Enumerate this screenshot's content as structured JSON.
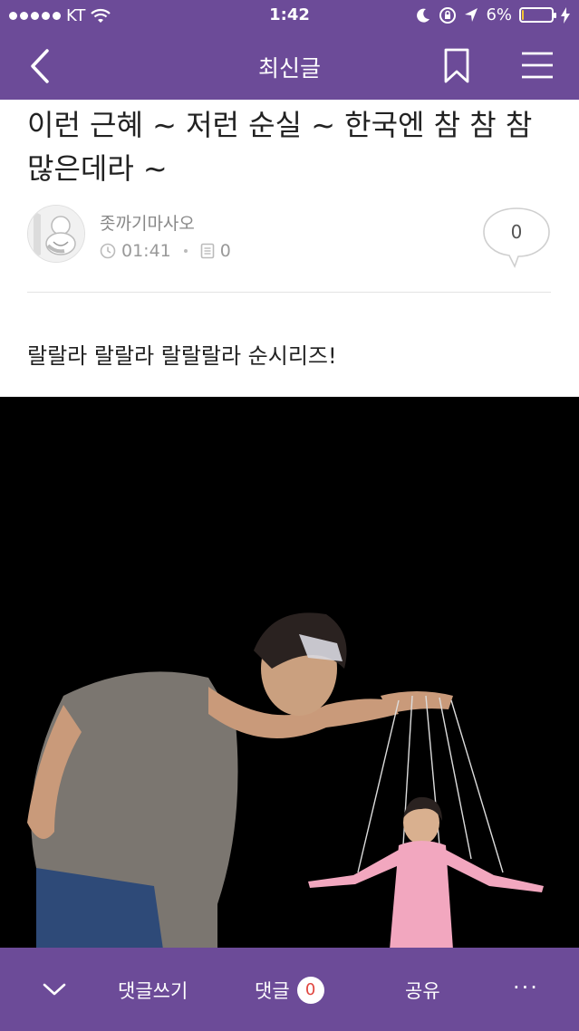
{
  "status_bar": {
    "carrier": "KT",
    "time": "1:42",
    "battery": "6%",
    "battery_level": 0.06
  },
  "nav": {
    "title": "최신글",
    "icons": [
      "back-icon",
      "bookmark-icon",
      "menu-icon"
    ]
  },
  "article": {
    "title": "이런 근혜 ~ 저런 순실 ~ 한국엔 참 참 참 많은데라 ~",
    "author": "좃까기마사오",
    "time": "01:41",
    "views": "0",
    "comment_count": "0",
    "body": "랄랄라 랄랄라 랄랄랄라 순시리즈!"
  },
  "bottom_bar": {
    "write_label": "댓글쓰기",
    "comments_label": "댓글",
    "comments_count": "0",
    "share_label": "공유",
    "more_label": "···"
  },
  "colors": {
    "brand": "#6c4b98",
    "badge_text": "#e0463f"
  }
}
